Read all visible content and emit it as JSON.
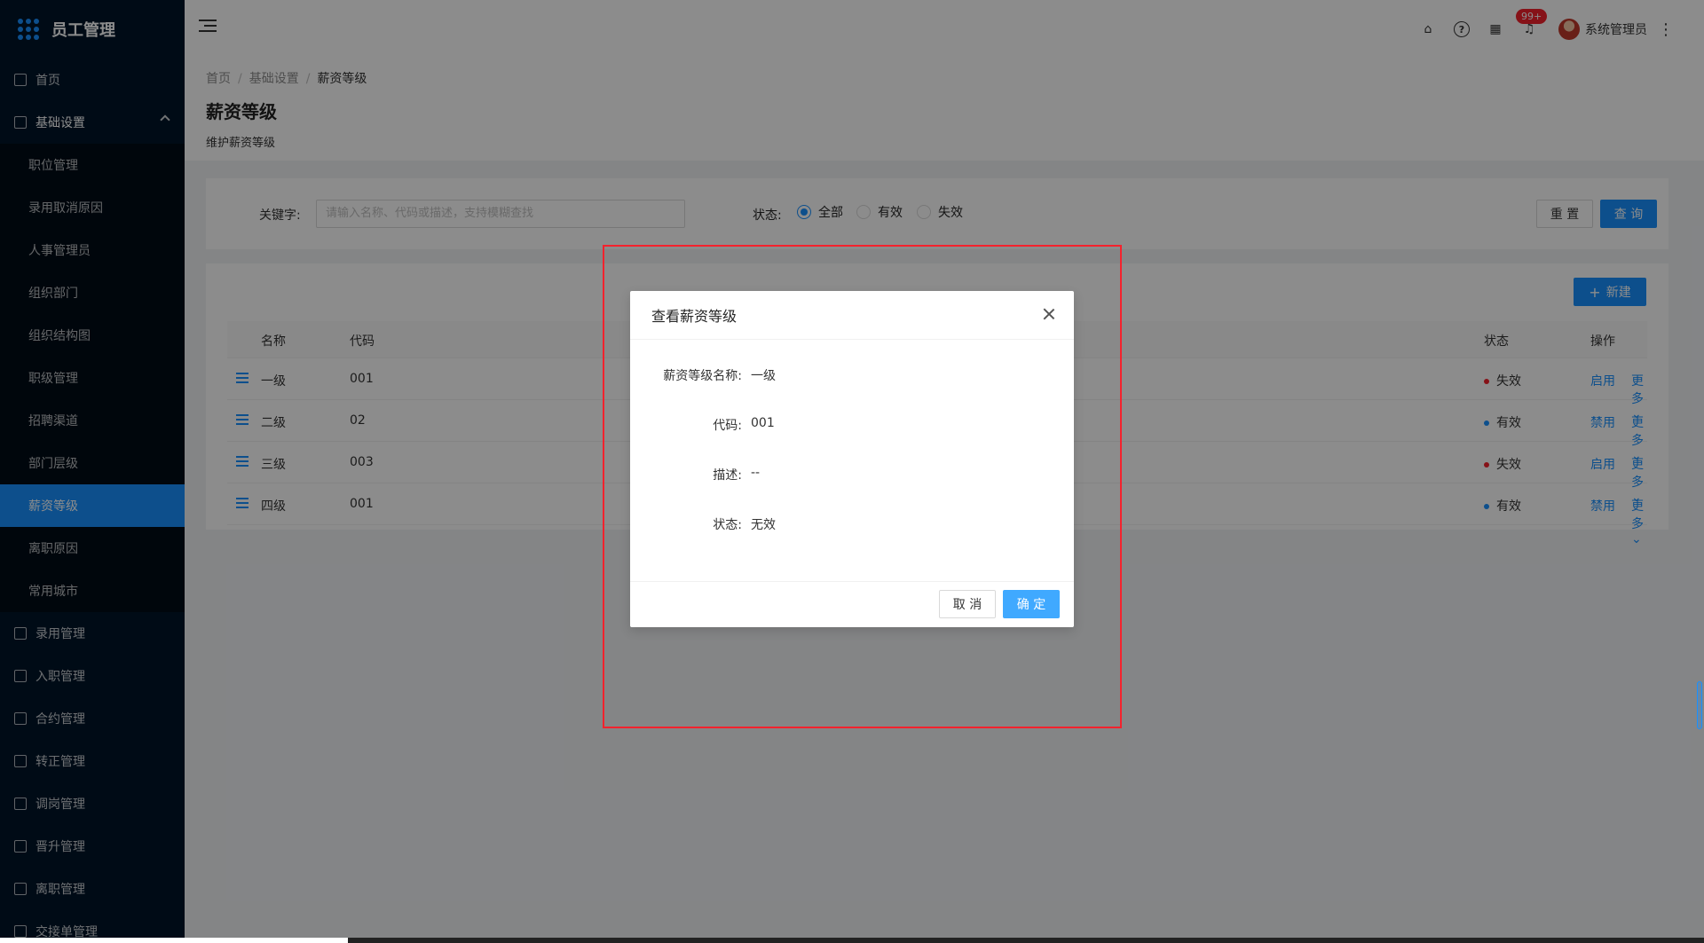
{
  "app": {
    "title": "员工管理"
  },
  "sidebar": {
    "items_top": [
      {
        "label": "首页",
        "icon": "home-icon"
      },
      {
        "label": "基础设置",
        "icon": "mail-icon"
      }
    ],
    "sub_items": [
      {
        "label": "职位管理"
      },
      {
        "label": "录用取消原因"
      },
      {
        "label": "人事管理员"
      },
      {
        "label": "组织部门"
      },
      {
        "label": "组织结构图"
      },
      {
        "label": "职级管理"
      },
      {
        "label": "招聘渠道"
      },
      {
        "label": "部门层级"
      },
      {
        "label": "薪资等级"
      },
      {
        "label": "离职原因"
      },
      {
        "label": "常用城市"
      }
    ],
    "items_bottom": [
      {
        "label": "录用管理"
      },
      {
        "label": "入职管理"
      },
      {
        "label": "合约管理"
      },
      {
        "label": "转正管理"
      },
      {
        "label": "调岗管理"
      },
      {
        "label": "晋升管理"
      },
      {
        "label": "离职管理"
      },
      {
        "label": "交接单管理"
      }
    ],
    "active_sub": "薪资等级"
  },
  "header": {
    "badge": "99+",
    "user": "系统管理员",
    "help_glyph": "?"
  },
  "page": {
    "breadcrumb": [
      "首页",
      "基础设置",
      "薪资等级"
    ],
    "title": "薪资等级",
    "description": "维护薪资等级"
  },
  "search": {
    "keyword_label": "关键字:",
    "placeholder": "请输入名称、代码或描述，支持模糊查找",
    "status_label": "状态:",
    "options": [
      "全部",
      "有效",
      "失效"
    ],
    "selected": "全部",
    "reset_label": "重 置",
    "query_label": "查 询"
  },
  "table": {
    "new_label": "新建",
    "columns": [
      "名称",
      "代码",
      "状态",
      "操作"
    ],
    "more_label": "更多",
    "rows": [
      {
        "name": "一级",
        "code": "001",
        "status": "失效",
        "status_color": "#f5222d",
        "action": "启用"
      },
      {
        "name": "二级",
        "code": "02",
        "status": "有效",
        "status_color": "#1890ff",
        "action": "禁用"
      },
      {
        "name": "三级",
        "code": "003",
        "status": "失效",
        "status_color": "#f5222d",
        "action": "启用"
      },
      {
        "name": "四级",
        "code": "001",
        "status": "有效",
        "status_color": "#1890ff",
        "action": "禁用"
      }
    ]
  },
  "modal": {
    "title": "查看薪资等级",
    "fields": [
      {
        "label": "薪资等级名称:",
        "value": "一级"
      },
      {
        "label": "代码:",
        "value": "001"
      },
      {
        "label": "描述:",
        "value": "--"
      },
      {
        "label": "状态:",
        "value": "无效"
      }
    ],
    "cancel_label": "取 消",
    "ok_label": "确 定"
  },
  "colors": {
    "primary": "#1890ff",
    "sidebar_bg": "#001529",
    "highlight": "#f5222d"
  }
}
